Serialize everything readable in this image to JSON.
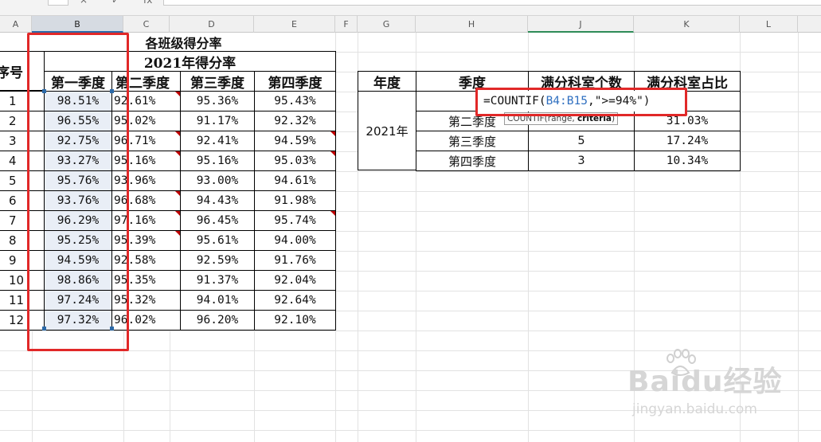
{
  "formula_bar_glyphs": [
    "×",
    "✓",
    "fx"
  ],
  "columns": [
    "A",
    "B",
    "C",
    "D",
    "E",
    "F",
    "G",
    "H",
    "J",
    "K",
    "L"
  ],
  "selected_column": "B",
  "left_table": {
    "title": "各班级得分率",
    "year_header": "2021年得分率",
    "index_header": "序号",
    "quarter_headers": [
      "第一季度",
      "第二季度",
      "第三季度",
      "第四季度"
    ],
    "rows": [
      {
        "idx": "1",
        "q1": "98.51%",
        "q2": "92.61%",
        "q3": "95.36%",
        "q4": "95.43%"
      },
      {
        "idx": "2",
        "q1": "96.55%",
        "q2": "95.02%",
        "q3": "91.17%",
        "q4": "92.32%"
      },
      {
        "idx": "3",
        "q1": "92.75%",
        "q2": "96.71%",
        "q3": "92.41%",
        "q4": "94.59%"
      },
      {
        "idx": "4",
        "q1": "93.27%",
        "q2": "95.16%",
        "q3": "95.16%",
        "q4": "95.03%"
      },
      {
        "idx": "5",
        "q1": "95.76%",
        "q2": "93.96%",
        "q3": "93.00%",
        "q4": "94.61%"
      },
      {
        "idx": "6",
        "q1": "93.76%",
        "q2": "96.68%",
        "q3": "94.43%",
        "q4": "91.98%"
      },
      {
        "idx": "7",
        "q1": "96.29%",
        "q2": "97.16%",
        "q3": "96.45%",
        "q4": "95.74%"
      },
      {
        "idx": "8",
        "q1": "95.25%",
        "q2": "95.39%",
        "q3": "95.61%",
        "q4": "94.00%"
      },
      {
        "idx": "9",
        "q1": "94.59%",
        "q2": "92.58%",
        "q3": "92.59%",
        "q4": "91.76%"
      },
      {
        "idx": "10",
        "q1": "98.86%",
        "q2": "95.35%",
        "q3": "91.37%",
        "q4": "92.04%"
      },
      {
        "idx": "11",
        "q1": "97.24%",
        "q2": "95.32%",
        "q3": "94.01%",
        "q4": "92.64%"
      },
      {
        "idx": "12",
        "q1": "97.32%",
        "q2": "96.02%",
        "q3": "96.20%",
        "q4": "92.10%"
      }
    ]
  },
  "right_table": {
    "headers": [
      "年度",
      "季度",
      "满分科室个数",
      "满分科室占比"
    ],
    "year": "2021年",
    "formula_prefix": "=COUNTIF(",
    "formula_ref": "B4:B15",
    "formula_suffix": ",\">=94%\")",
    "tooltip_prefix": "COUNTIF(range, ",
    "tooltip_bold": "criteria",
    "tooltip_suffix": ")",
    "rows": [
      {
        "quarter": "第二季度",
        "count": "",
        "ratio": "31.03%"
      },
      {
        "quarter": "第三季度",
        "count": "5",
        "ratio": "17.24%"
      },
      {
        "quarter": "第四季度",
        "count": "3",
        "ratio": "10.34%"
      }
    ]
  },
  "watermark": {
    "brand": "Baidu经验",
    "url": "jingyan.baidu.com"
  },
  "colors": {
    "annotation_red": "#e12828",
    "selection_blue": "#2c6aa8",
    "reference_blue": "#2f6fc0",
    "comment_marker": "#c00000"
  }
}
